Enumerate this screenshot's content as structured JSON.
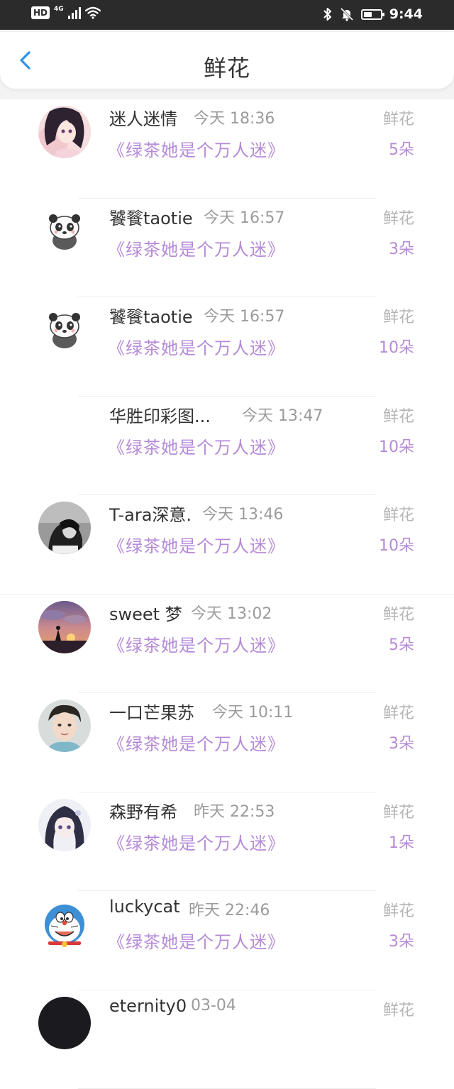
{
  "status_bar": {
    "network_badge": "HD",
    "network_type": "4G",
    "time": "9:44",
    "battery_level": 0.5
  },
  "header": {
    "title": "鲜花",
    "back_icon": "chevron-left-icon"
  },
  "items": [
    {
      "user": "迷人迷情",
      "time": "今天 18:36",
      "book": "《绿茶她是个万人迷》",
      "gift": "鲜花",
      "count": "5朵",
      "avatar": "anime-girl"
    },
    {
      "user": "饕餮taotie",
      "time": "今天 16:57",
      "book": "《绿茶她是个万人迷》",
      "gift": "鲜花",
      "count": "3朵",
      "avatar": "panda"
    },
    {
      "user": "饕餮taotie",
      "time": "今天 16:57",
      "book": "《绿茶她是个万人迷》",
      "gift": "鲜花",
      "count": "10朵",
      "avatar": "panda"
    },
    {
      "user": "华胜印彩图...",
      "time": "今天 13:47",
      "book": "《绿茶她是个万人迷》",
      "gift": "鲜花",
      "count": "10朵",
      "avatar": "none"
    },
    {
      "user": "T-ara深意.",
      "time": "今天 13:46",
      "book": "《绿茶她是个万人迷》",
      "gift": "鲜花",
      "count": "10朵",
      "avatar": "girl-bw"
    },
    {
      "user": "sweet 梦",
      "time": "今天 13:02",
      "book": "《绿茶她是个万人迷》",
      "gift": "鲜花",
      "count": "5朵",
      "avatar": "sunset"
    },
    {
      "user": "一口芒果苏",
      "time": "今天 10:11",
      "book": "《绿茶她是个万人迷》",
      "gift": "鲜花",
      "count": "3朵",
      "avatar": "boy"
    },
    {
      "user": "森野有希",
      "time": "昨天 22:53",
      "book": "《绿茶她是个万人迷》",
      "gift": "鲜花",
      "count": "1朵",
      "avatar": "anime-dark-hair"
    },
    {
      "user": "luckycat",
      "time": "昨天 22:46",
      "book": "《绿茶她是个万人迷》",
      "gift": "鲜花",
      "count": "3朵",
      "avatar": "doraemon"
    },
    {
      "user": "eternity0",
      "time": "03-04",
      "book": "",
      "gift": "鲜花",
      "count": "",
      "avatar": "dark"
    }
  ]
}
